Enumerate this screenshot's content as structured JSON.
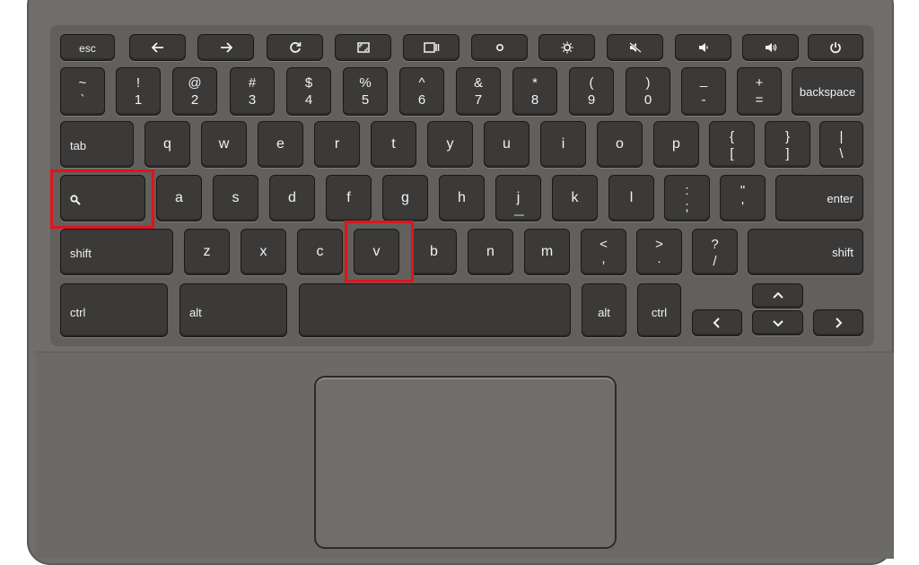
{
  "function_row": {
    "esc": "esc"
  },
  "number_row": [
    {
      "top": "~",
      "bottom": "`"
    },
    {
      "top": "!",
      "bottom": "1"
    },
    {
      "top": "@",
      "bottom": "2"
    },
    {
      "top": "#",
      "bottom": "3"
    },
    {
      "top": "$",
      "bottom": "4"
    },
    {
      "top": "%",
      "bottom": "5"
    },
    {
      "top": "^",
      "bottom": "6"
    },
    {
      "top": "&",
      "bottom": "7"
    },
    {
      "top": "*",
      "bottom": "8"
    },
    {
      "top": "(",
      "bottom": "9"
    },
    {
      "top": ")",
      "bottom": "0"
    },
    {
      "top": "_",
      "bottom": "-"
    },
    {
      "top": "+",
      "bottom": "="
    }
  ],
  "backspace": "backspace",
  "tab": "tab",
  "row_q": [
    "q",
    "w",
    "e",
    "r",
    "t",
    "y",
    "u",
    "i",
    "o",
    "p"
  ],
  "bracket_keys": [
    {
      "top": "{",
      "bottom": "["
    },
    {
      "top": "}",
      "bottom": "]"
    },
    {
      "top": "|",
      "bottom": "\\"
    }
  ],
  "row_a": [
    "a",
    "s",
    "d",
    "f",
    "g",
    "h",
    "j",
    "k",
    "l"
  ],
  "home_punct": [
    {
      "top": ":",
      "bottom": ";"
    },
    {
      "top": "\"",
      "bottom": "'"
    }
  ],
  "enter": "enter",
  "shift_left": "shift",
  "row_z": [
    "z",
    "x",
    "c",
    "v",
    "b",
    "n",
    "m"
  ],
  "angle_keys": [
    {
      "top": "<",
      "bottom": ","
    },
    {
      "top": ">",
      "bottom": "."
    },
    {
      "top": "?",
      "bottom": "/"
    }
  ],
  "shift_right": "shift",
  "ctrl_left": "ctrl",
  "alt_left": "alt",
  "alt_right": "alt",
  "ctrl_right": "ctrl",
  "highlight_color": "#e0141b",
  "key_color": "#3b3a39",
  "chassis_color": "#6f6e6c",
  "icons": [
    "back-arrow-icon",
    "forward-arrow-icon",
    "refresh-icon",
    "fullscreen-icon",
    "overview-icon",
    "brightness-down-icon",
    "brightness-up-icon",
    "mute-icon",
    "volume-down-icon",
    "volume-up-icon",
    "power-icon",
    "search-icon",
    "arrow-left-icon",
    "arrow-up-icon",
    "arrow-down-icon",
    "arrow-right-icon"
  ]
}
